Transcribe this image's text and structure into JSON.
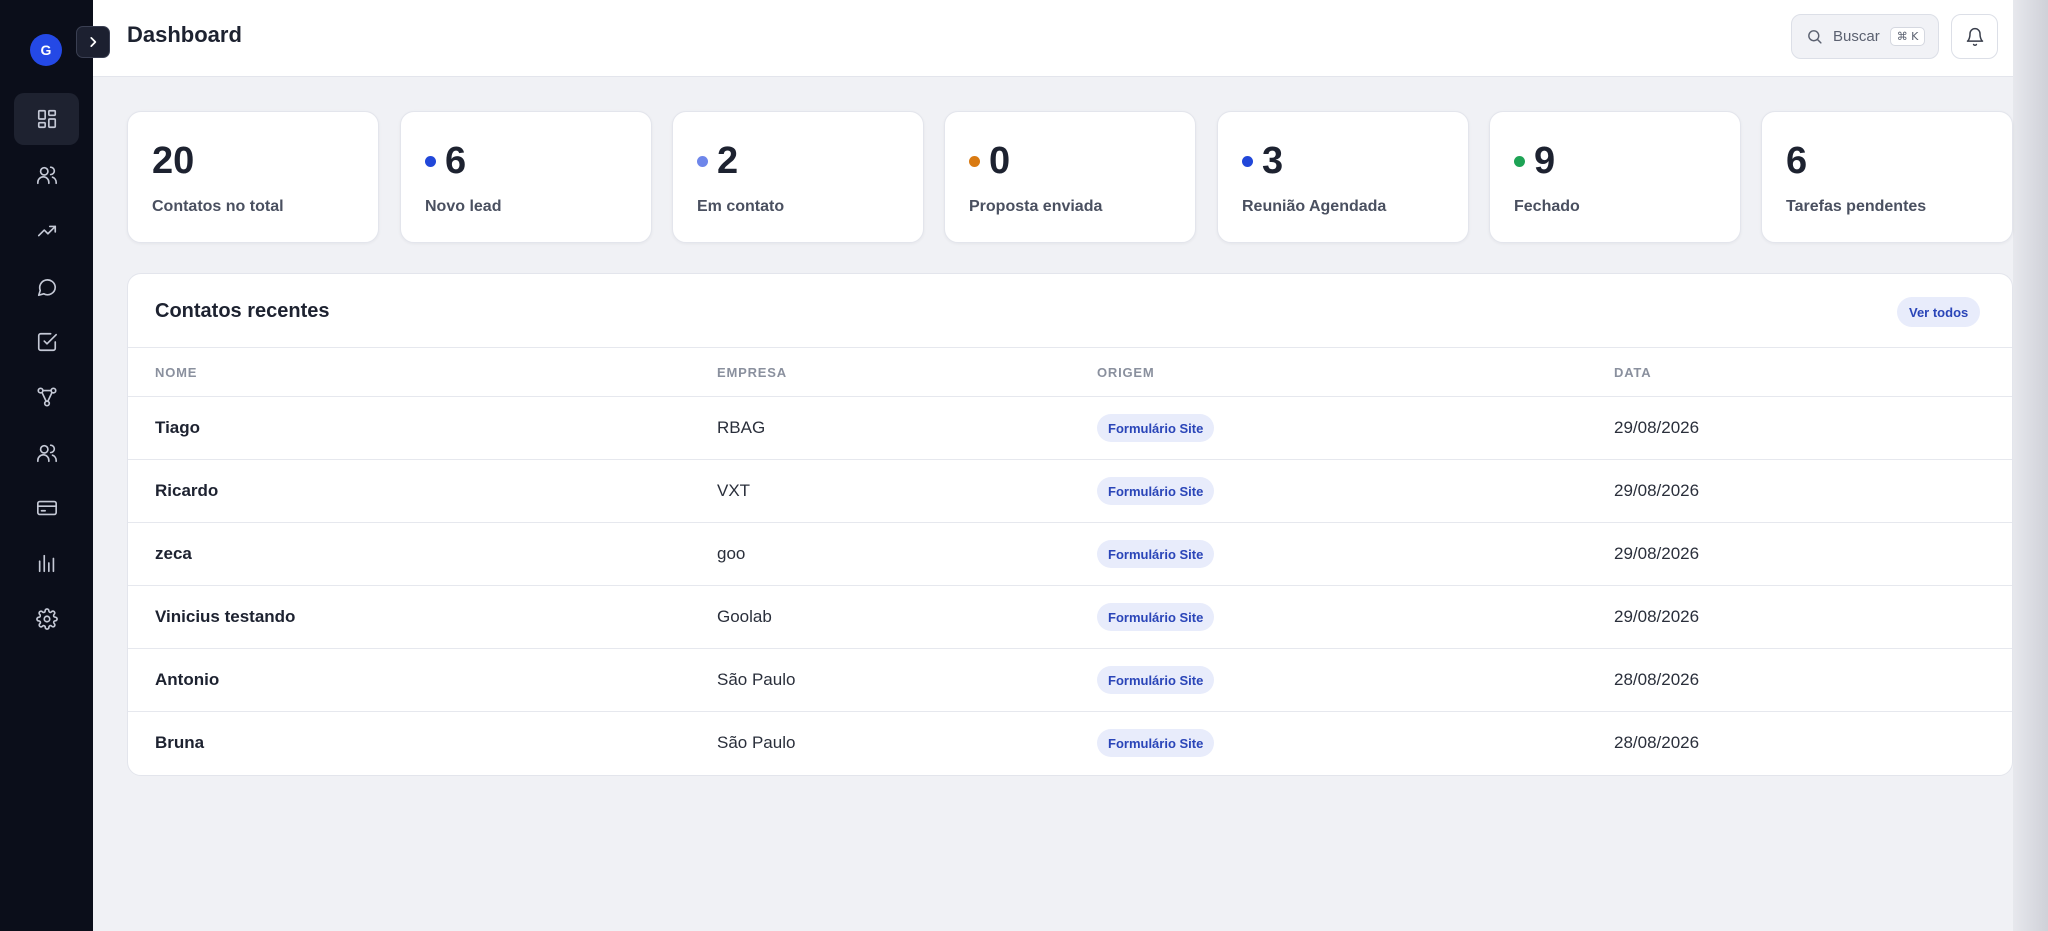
{
  "app": {
    "avatar_initial": "G"
  },
  "header": {
    "title": "Dashboard",
    "search_label": "Buscar",
    "search_shortcut": "⌘ K"
  },
  "sidebar": {
    "items": [
      {
        "icon": "dashboard-icon",
        "active": true
      },
      {
        "icon": "contacts-icon"
      },
      {
        "icon": "trending-icon"
      },
      {
        "icon": "chat-icon"
      },
      {
        "icon": "tasks-icon"
      },
      {
        "icon": "pipeline-icon"
      },
      {
        "icon": "team-icon"
      },
      {
        "icon": "billing-icon"
      },
      {
        "icon": "reports-icon"
      },
      {
        "icon": "settings-icon"
      }
    ]
  },
  "stats": [
    {
      "value": "20",
      "label": "Contatos no total",
      "dot": ""
    },
    {
      "value": "6",
      "label": "Novo lead",
      "dot": "#2147d9"
    },
    {
      "value": "2",
      "label": "Em contato",
      "dot": "#6e86ea"
    },
    {
      "value": "0",
      "label": "Proposta enviada",
      "dot": "#d97a12"
    },
    {
      "value": "3",
      "label": "Reunião Agendada",
      "dot": "#2147d9"
    },
    {
      "value": "9",
      "label": "Fechado",
      "dot": "#1ea355"
    },
    {
      "value": "6",
      "label": "Tarefas pendentes",
      "dot": ""
    }
  ],
  "recent": {
    "title": "Contatos recentes",
    "see_all": "Ver todos",
    "columns": [
      "NOME",
      "EMPRESA",
      "ORIGEM",
      "DATA"
    ],
    "rows": [
      {
        "name": "Tiago",
        "company": "RBAG",
        "origin": "Formulário Site",
        "date": "29/08/2026"
      },
      {
        "name": "Ricardo",
        "company": "VXT",
        "origin": "Formulário Site",
        "date": "29/08/2026"
      },
      {
        "name": "zeca",
        "company": "goo",
        "origin": "Formulário Site",
        "date": "29/08/2026"
      },
      {
        "name": "Vinicius testando",
        "company": "Goolab",
        "origin": "Formulário Site",
        "date": "29/08/2026"
      },
      {
        "name": "Antonio",
        "company": "São Paulo",
        "origin": "Formulário Site",
        "date": "28/08/2026"
      },
      {
        "name": "Bruna",
        "company": "São Paulo",
        "origin": "Formulário Site",
        "date": "28/08/2026"
      }
    ]
  },
  "colors": {
    "sidebar_bg": "#0b0e1a",
    "accent": "#2449e6",
    "badge_bg": "#e8ecfb",
    "badge_text": "#2a45b8"
  }
}
